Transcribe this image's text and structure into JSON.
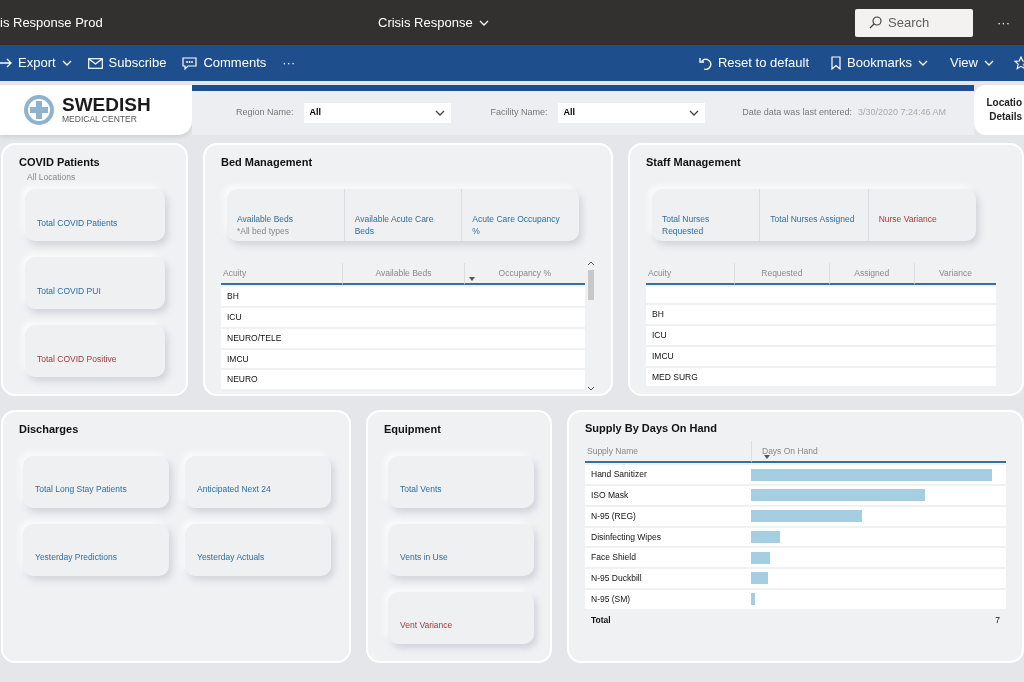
{
  "app_bar": {
    "workspace": "is Response Prod",
    "report_title": "Crisis Response",
    "search": {
      "placeholder": "Search"
    },
    "more": "···"
  },
  "action_bar": {
    "left": [
      {
        "label": "Export",
        "caret": true
      },
      {
        "label": "Subscribe",
        "caret": false
      },
      {
        "label": "Comments",
        "caret": false
      }
    ],
    "more": "···",
    "right": [
      {
        "label": "Reset to default",
        "caret": false
      },
      {
        "label": "Bookmarks",
        "caret": true
      },
      {
        "label": "View",
        "caret": true
      }
    ]
  },
  "header": {
    "logo": {
      "name": "SWEDISH",
      "subtitle": "MEDICAL CENTER"
    },
    "filters": [
      {
        "label": "Region Name:",
        "value": "All"
      },
      {
        "label": "Facility Name:",
        "value": "All"
      }
    ],
    "last_entered": {
      "label": "Date data was last entered:",
      "value": "3/30/2020 7:24:46 AM"
    },
    "location_details": [
      "Locatio",
      "Details"
    ]
  },
  "covid_patients": {
    "title": "COVID Patients",
    "subtitle": "All Locations",
    "cards": [
      {
        "label": "Total COVID Patients",
        "kind": "normal"
      },
      {
        "label": "Total COVID PUI",
        "kind": "normal"
      },
      {
        "label": "Total COVID Positive",
        "kind": "alert"
      }
    ]
  },
  "bed_management": {
    "title": "Bed Management",
    "kpis": [
      {
        "label": "Available Beds",
        "note": "*All bed types",
        "kind": "normal"
      },
      {
        "label": "Available Acute Care Beds",
        "kind": "normal"
      },
      {
        "label": "Acute Care Occupancy %",
        "kind": "normal"
      }
    ],
    "table": {
      "columns": [
        "Acuity",
        "Available Beds",
        "Occupancy %"
      ],
      "rows": [
        {
          "acuity": "BH"
        },
        {
          "acuity": "ICU"
        },
        {
          "acuity": "NEURO/TELE"
        },
        {
          "acuity": "IMCU"
        },
        {
          "acuity": "NEURO"
        }
      ]
    }
  },
  "staff_management": {
    "title": "Staff Management",
    "kpis": [
      {
        "label": "Total Nurses Requested",
        "kind": "normal"
      },
      {
        "label": "Total Nurses Assigned",
        "kind": "normal"
      },
      {
        "label": "Nurse Variance",
        "kind": "alert"
      }
    ],
    "table": {
      "columns": [
        "Acuity",
        "Requested",
        "Assigned",
        "Variance"
      ],
      "rows": [
        {},
        {
          "acuity": "BH"
        },
        {
          "acuity": "ICU"
        },
        {
          "acuity": "IMCU"
        },
        {
          "acuity": "MED SURG"
        }
      ]
    }
  },
  "discharges": {
    "title": "Discharges",
    "cards": [
      {
        "label": "Total Long Stay Patients",
        "kind": "normal"
      },
      {
        "label": "Anticipated Next 24",
        "kind": "normal"
      },
      {
        "label": "Yesterday Predictions",
        "kind": "normal"
      },
      {
        "label": "Yesterday Actuals",
        "kind": "normal"
      }
    ]
  },
  "equipment": {
    "title": "Equipment",
    "cards": [
      {
        "label": "Total Vents",
        "kind": "normal"
      },
      {
        "label": "Vents in Use",
        "kind": "normal"
      },
      {
        "label": "Vent Variance",
        "kind": "alert"
      }
    ]
  },
  "supply": {
    "title": "Supply By Days On Hand",
    "columns": [
      "Supply Name",
      "Days On Hand"
    ],
    "rows": [
      {
        "name": "Hand Sanitizer",
        "level": 1.0
      },
      {
        "name": "ISO Mask",
        "level": 0.72
      },
      {
        "name": "N-95 (REG)",
        "level": 0.46
      },
      {
        "name": "Disinfecting Wipes",
        "level": 0.12
      },
      {
        "name": "Face Shield",
        "level": 0.08
      },
      {
        "name": "N-95 Duckbill",
        "level": 0.07
      },
      {
        "name": "N-95 (SM)",
        "level": 0.015
      }
    ],
    "total": {
      "label": "Total",
      "value": "7"
    }
  }
}
